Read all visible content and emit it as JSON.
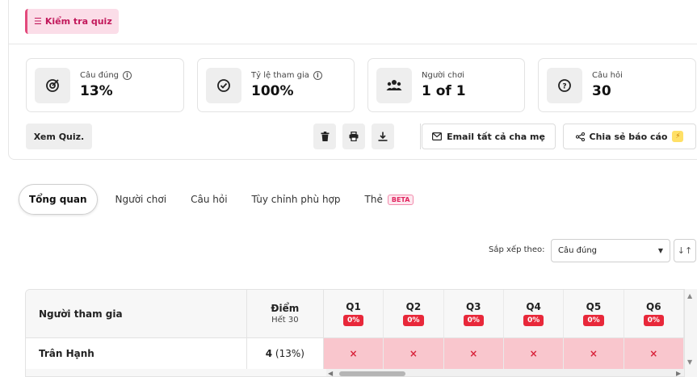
{
  "header": {
    "quiz_tag": "Kiểm tra quiz"
  },
  "stats": [
    {
      "label": "Câu đúng",
      "value": "13%",
      "icon": "target-icon",
      "info": true
    },
    {
      "label": "Tỷ lệ tham gia",
      "value": "100%",
      "icon": "check-circle-icon",
      "info": true
    },
    {
      "label": "Người chơi",
      "value": "1 of 1",
      "icon": "users-icon",
      "info": false
    },
    {
      "label": "Câu hỏi",
      "value": "30",
      "icon": "question-circle-icon",
      "info": false
    }
  ],
  "actions": {
    "view_quiz": "Xem Quiz.",
    "delete_icon": "trash-icon",
    "print_icon": "printer-icon",
    "download_icon": "download-icon",
    "email_parents": "Email tất cả cha mẹ",
    "share_report": "Chia sẻ báo cáo"
  },
  "tabs": [
    {
      "label": "Tổng quan",
      "active": true
    },
    {
      "label": "Người chơi",
      "active": false
    },
    {
      "label": "Câu hỏi",
      "active": false
    },
    {
      "label": "Tùy chỉnh phù hợp",
      "active": false
    },
    {
      "label": "Thẻ",
      "active": false,
      "badge": "BETA"
    }
  ],
  "sort": {
    "label": "Sắp xếp theo:",
    "selected": "Câu đúng"
  },
  "table": {
    "col_participant": "Người tham gia",
    "col_score": "Điểm",
    "col_score_sub": "Hết 30",
    "questions": [
      {
        "label": "Q1",
        "pct": "0%"
      },
      {
        "label": "Q2",
        "pct": "0%"
      },
      {
        "label": "Q3",
        "pct": "0%"
      },
      {
        "label": "Q4",
        "pct": "0%"
      },
      {
        "label": "Q5",
        "pct": "0%"
      },
      {
        "label": "Q6",
        "pct": "0%"
      }
    ],
    "rows": [
      {
        "name": "Trân Hạnh",
        "score": "4",
        "score_pct": "(13%)",
        "answers": [
          "×",
          "×",
          "×",
          "×",
          "×",
          "×"
        ]
      }
    ]
  },
  "colors": {
    "accent_pink": "#e34a7c",
    "wrong_red": "#e8283a",
    "wrong_cell": "#f9c6cd"
  }
}
